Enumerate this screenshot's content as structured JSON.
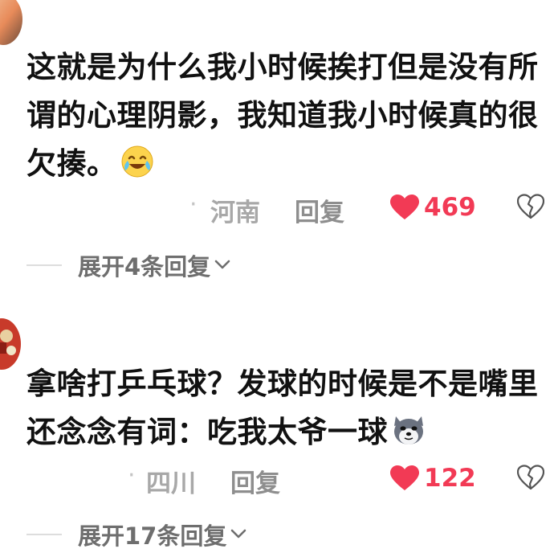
{
  "comments": [
    {
      "text": "这就是为什么我小时候挨打但是没有所谓的心理阴影，我知道我小时候真的很欠揍。",
      "emoji": "laughing-crying-emoji",
      "dots": "·",
      "location": "河南",
      "reply_label": "回复",
      "likes": "469",
      "expand_label": "展开4条回复"
    },
    {
      "text": "拿啥打乒乓球？发球的时候是不是嘴里还念念有词：吃我太爷一球",
      "emoji": "doge-emoji",
      "dots": "·",
      "location": "四川",
      "reply_label": "回复",
      "likes": "122",
      "expand_label": "展开17条回复"
    }
  ],
  "colors": {
    "like": "#f23a55",
    "location": "#a8a8a8",
    "reply": "#8e8e8e",
    "expand": "#6e6e6e"
  }
}
